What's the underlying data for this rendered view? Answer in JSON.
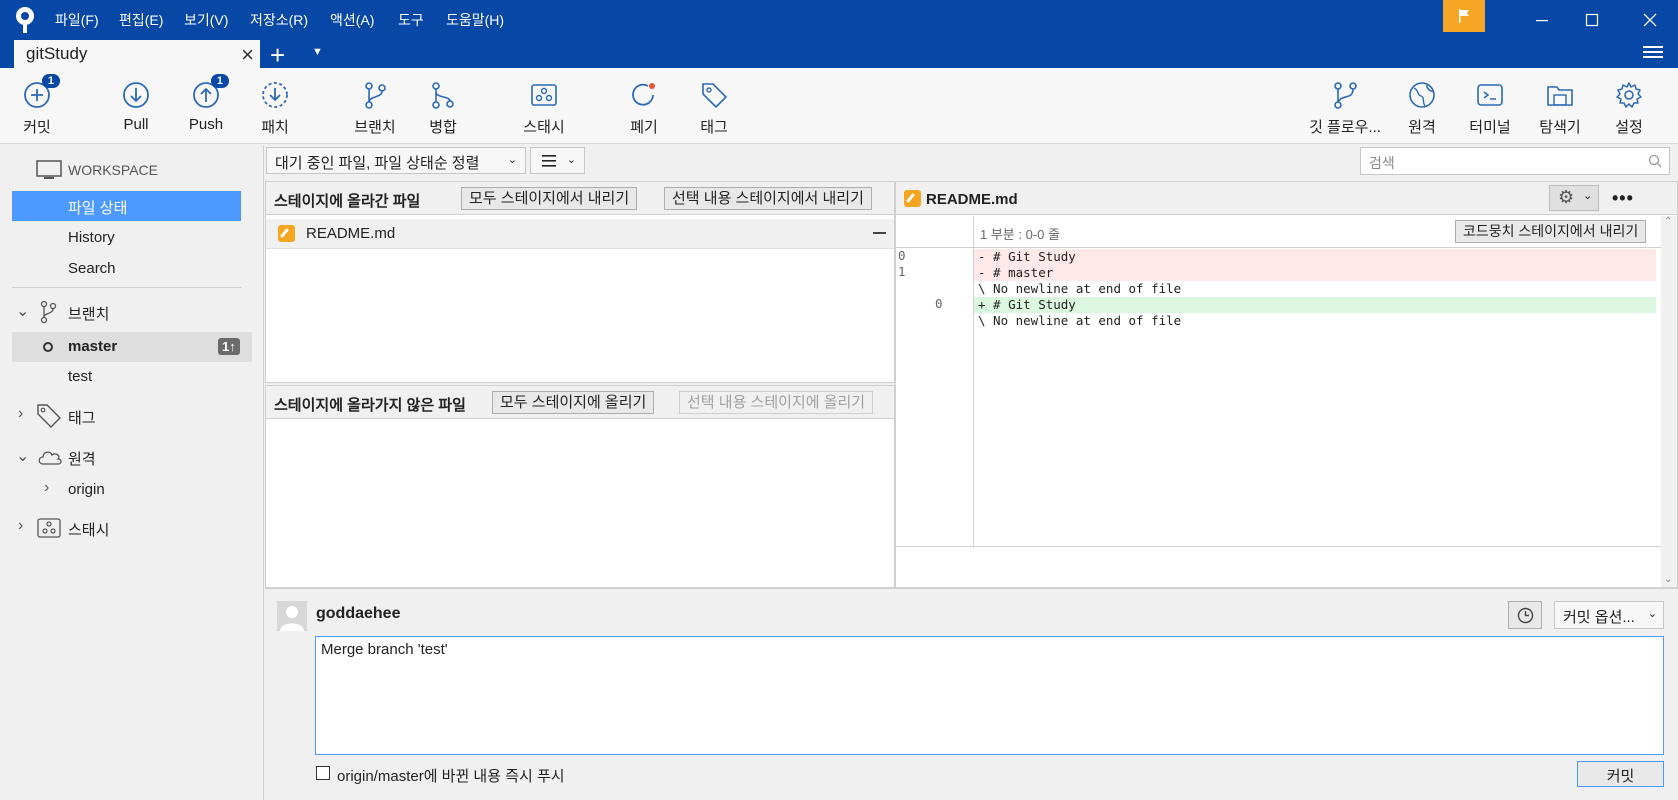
{
  "menu": [
    "파일(F)",
    "편집(E)",
    "보기(V)",
    "저장소(R)",
    "액션(A)",
    "도구",
    "도움말(H)"
  ],
  "tab": {
    "title": "gitStudy"
  },
  "toolbar": {
    "commit": {
      "label": "커밋",
      "badge": "1"
    },
    "pull": {
      "label": "Pull"
    },
    "push": {
      "label": "Push",
      "badge": "1"
    },
    "patch": {
      "label": "패치"
    },
    "branch": {
      "label": "브랜치"
    },
    "merge": {
      "label": "병합"
    },
    "stash": {
      "label": "스태시"
    },
    "discard": {
      "label": "폐기"
    },
    "tag": {
      "label": "태그"
    },
    "gitflow": {
      "label": "깃 플로우..."
    },
    "remote": {
      "label": "원격"
    },
    "terminal": {
      "label": "터미널"
    },
    "explorer": {
      "label": "탐색기"
    },
    "settings": {
      "label": "설정"
    }
  },
  "sidebar": {
    "workspace": "WORKSPACE",
    "file_status": "파일 상태",
    "history": "History",
    "search": "Search",
    "branches": "브랜치",
    "master": "master",
    "master_badge": "1↑",
    "test": "test",
    "tags": "태그",
    "remotes": "원격",
    "origin": "origin",
    "stashes": "스태시"
  },
  "filter": {
    "sort": "대기 중인 파일, 파일 상태순 정렬",
    "search_placeholder": "검색"
  },
  "staged": {
    "title": "스테이지에 올라간 파일",
    "unstage_all": "모두 스테이지에서 내리기",
    "unstage_selected": "선택 내용 스테이지에서 내리기",
    "files": [
      "README.md"
    ]
  },
  "unstaged": {
    "title": "스테이지에 올라가지 않은 파일",
    "stage_all": "모두 스테이지에 올리기",
    "stage_selected": "선택 내용 스테이지에 올리기"
  },
  "diff": {
    "file": "README.md",
    "hunk": "1 부분 : 0-0 줄",
    "unstage_hunk": "코드뭉치 스테이지에서 내리기",
    "lines": [
      {
        "old": "0",
        "new": "",
        "type": "del",
        "text": "- # Git Study"
      },
      {
        "old": "1",
        "new": "",
        "type": "del",
        "text": "- # master"
      },
      {
        "old": "",
        "new": "",
        "type": "ctx",
        "text": "\\  No newline at end of file"
      },
      {
        "old": "",
        "new": "0",
        "type": "add",
        "text": "+ # Git Study"
      },
      {
        "old": "",
        "new": "",
        "type": "ctx",
        "text": "\\  No newline at end of file"
      }
    ]
  },
  "commit": {
    "author": "goddaehee",
    "options": "커밋 옵션...",
    "message": "Merge branch 'test'",
    "push_option": "origin/master에 바뀐 내용 즉시 푸시",
    "commit_button": "커밋"
  }
}
